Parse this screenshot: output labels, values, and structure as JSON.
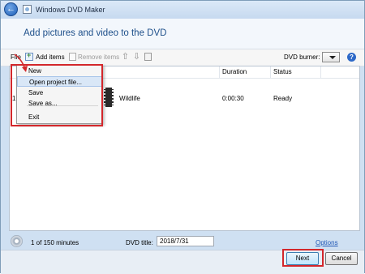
{
  "app": {
    "title": "Windows DVD Maker"
  },
  "header": {
    "title": "Add pictures and video to the DVD"
  },
  "toolbar": {
    "file": "File",
    "add_items": "Add items",
    "remove_items": "Remove items",
    "dvd_burner_label": "DVD burner:",
    "help": "?"
  },
  "file_menu": {
    "items": [
      "New",
      "Open project file...",
      "Save",
      "Save as...",
      "Exit"
    ],
    "highlighted": "Open project file..."
  },
  "list": {
    "columns": [
      "Duration",
      "Status"
    ],
    "rows": [
      {
        "order": "1",
        "name": "Wildlife",
        "duration": "0:00:30",
        "status": "Ready"
      }
    ]
  },
  "footer": {
    "minutes": "1 of 150 minutes",
    "dvd_title_label": "DVD title:",
    "dvd_title_value": "2018/7/31",
    "options": "Options"
  },
  "buttons": {
    "next": "Next",
    "cancel": "Cancel"
  },
  "colors": {
    "callout": "#d3272b",
    "header_text": "#1d4f8a",
    "link": "#1f56b4"
  }
}
